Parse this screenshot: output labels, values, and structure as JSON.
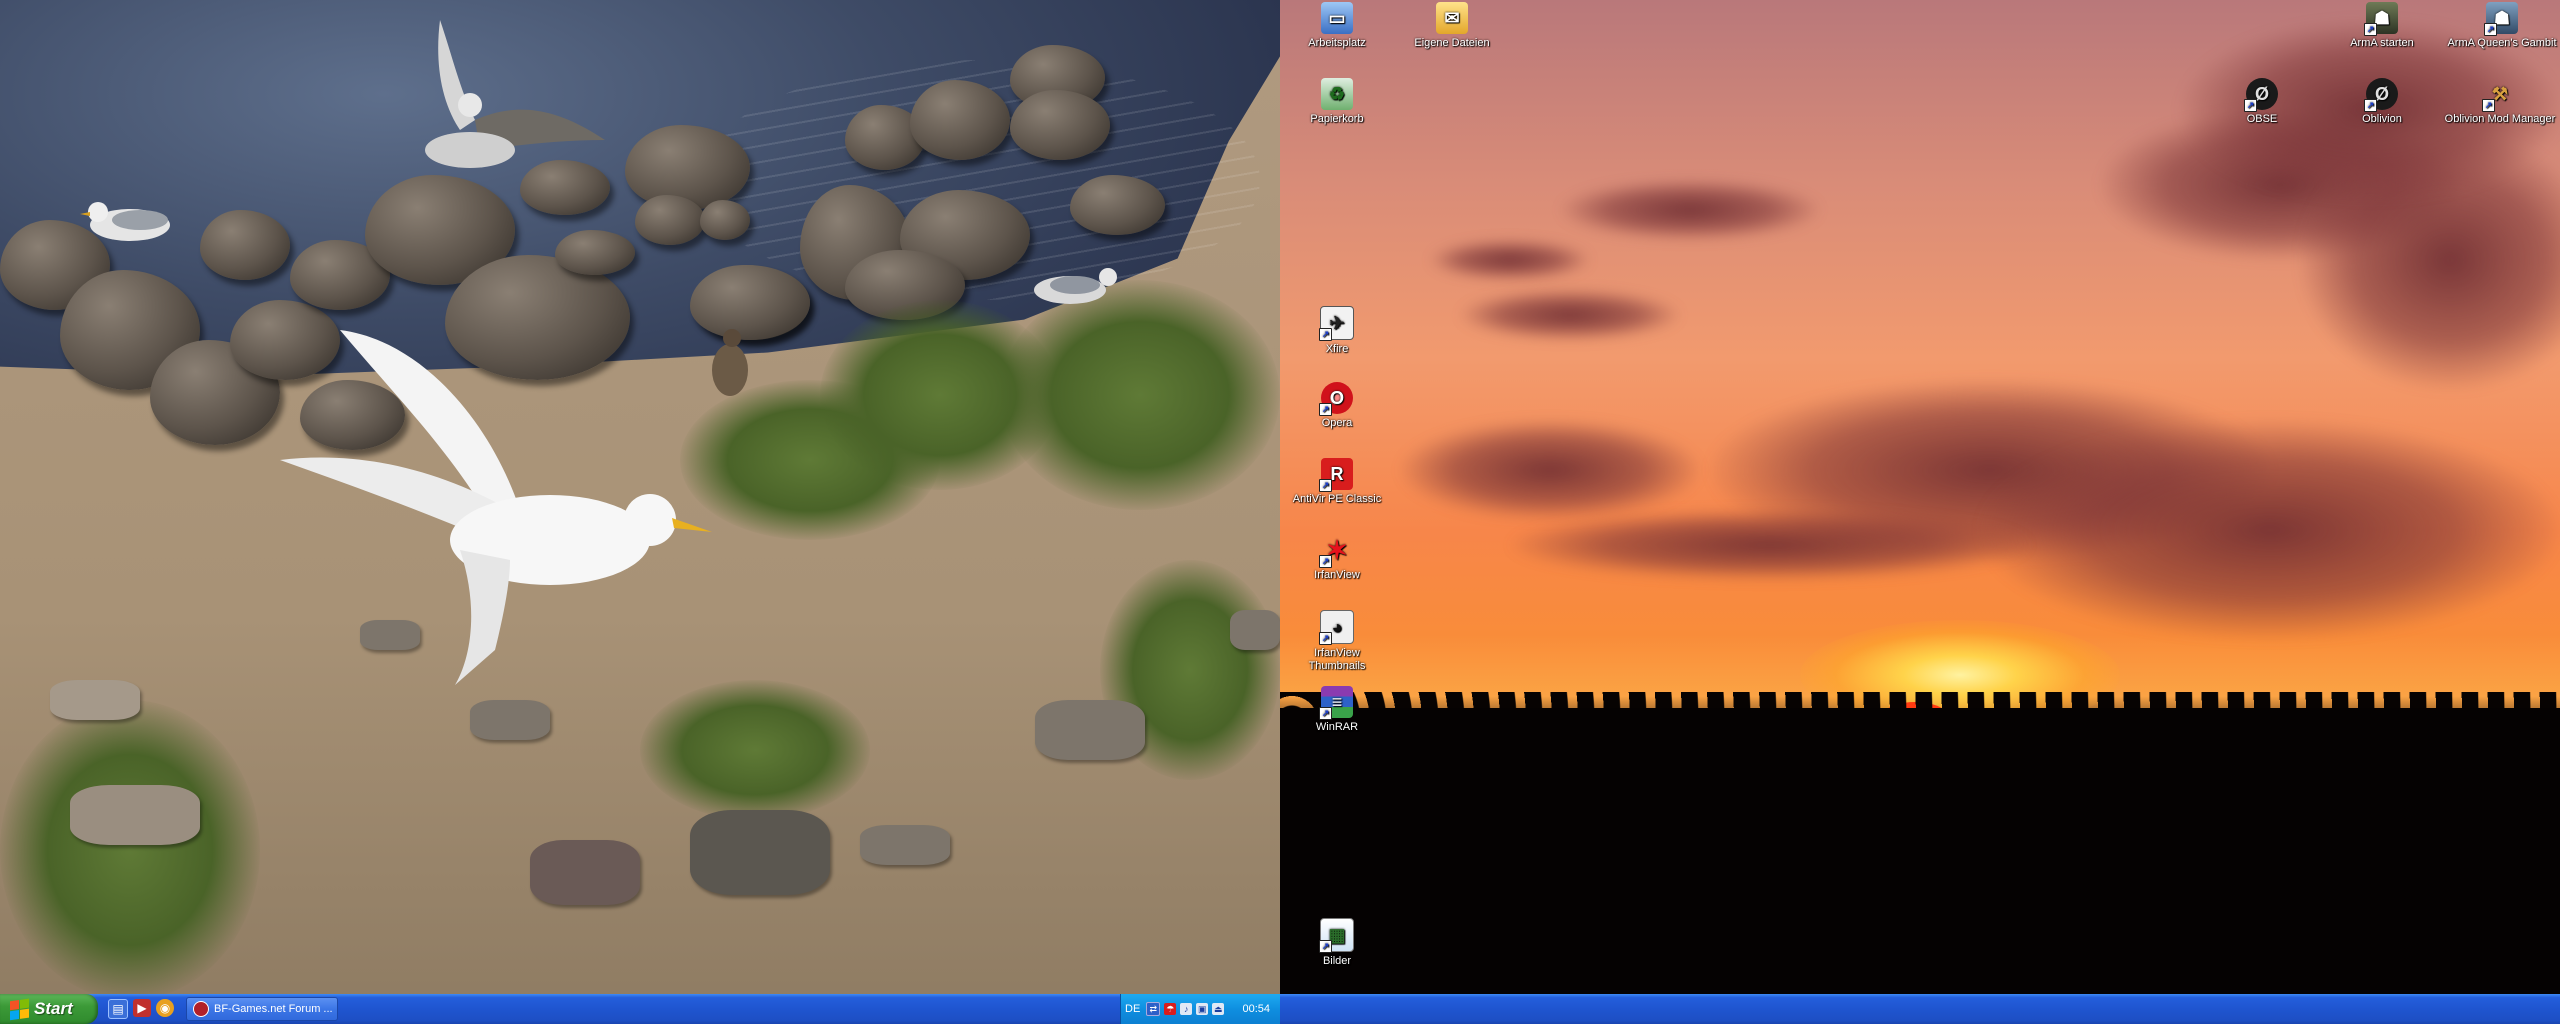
{
  "desktop": {
    "icons_left_column": [
      {
        "label": "Arbeitsplatz",
        "icon": "my-computer-icon"
      },
      {
        "label": "Papierkorb",
        "icon": "recycle-bin-icon"
      },
      {
        "label": "Xfire",
        "icon": "xfire-icon"
      },
      {
        "label": "Opera",
        "icon": "opera-icon"
      },
      {
        "label": "AntiVir PE Classic",
        "icon": "antivir-icon"
      },
      {
        "label": "IrfanView",
        "icon": "irfanview-icon"
      },
      {
        "label": "IrfanView Thumbnails",
        "icon": "irfanview-thumbnails-icon"
      },
      {
        "label": "WinRAR",
        "icon": "winrar-icon"
      },
      {
        "label": "Bilder",
        "icon": "pictures-folder-icon"
      }
    ],
    "icon_eigene_dateien": {
      "label": "Eigene Dateien",
      "icon": "my-documents-icon"
    },
    "icons_right_area": [
      {
        "label": "ArmA starten",
        "icon": "arma-icon"
      },
      {
        "label": "ArmA Queen's Gambit",
        "icon": "arma-queens-gambit-icon"
      },
      {
        "label": "OBSE",
        "icon": "obse-icon"
      },
      {
        "label": "Oblivion",
        "icon": "oblivion-icon"
      },
      {
        "label": "Oblivion Mod Manager",
        "icon": "oblivion-mod-manager-icon"
      }
    ]
  },
  "taskbar": {
    "start_label": "Start",
    "quick_launch": [
      "show-desktop-icon",
      "media-player-icon",
      "browser-icon"
    ],
    "task_button_label": "BF-Games.net Forum ...",
    "tray": {
      "language": "DE",
      "icons": [
        "network-icon",
        "antivirus-tray-icon",
        "volume-icon",
        "display-icon",
        "safely-remove-icon"
      ],
      "clock": "00:54"
    }
  },
  "colors": {
    "taskbar_blue": "#245edb",
    "start_green": "#3c9a38",
    "tray_blue": "#0f8fe0"
  }
}
